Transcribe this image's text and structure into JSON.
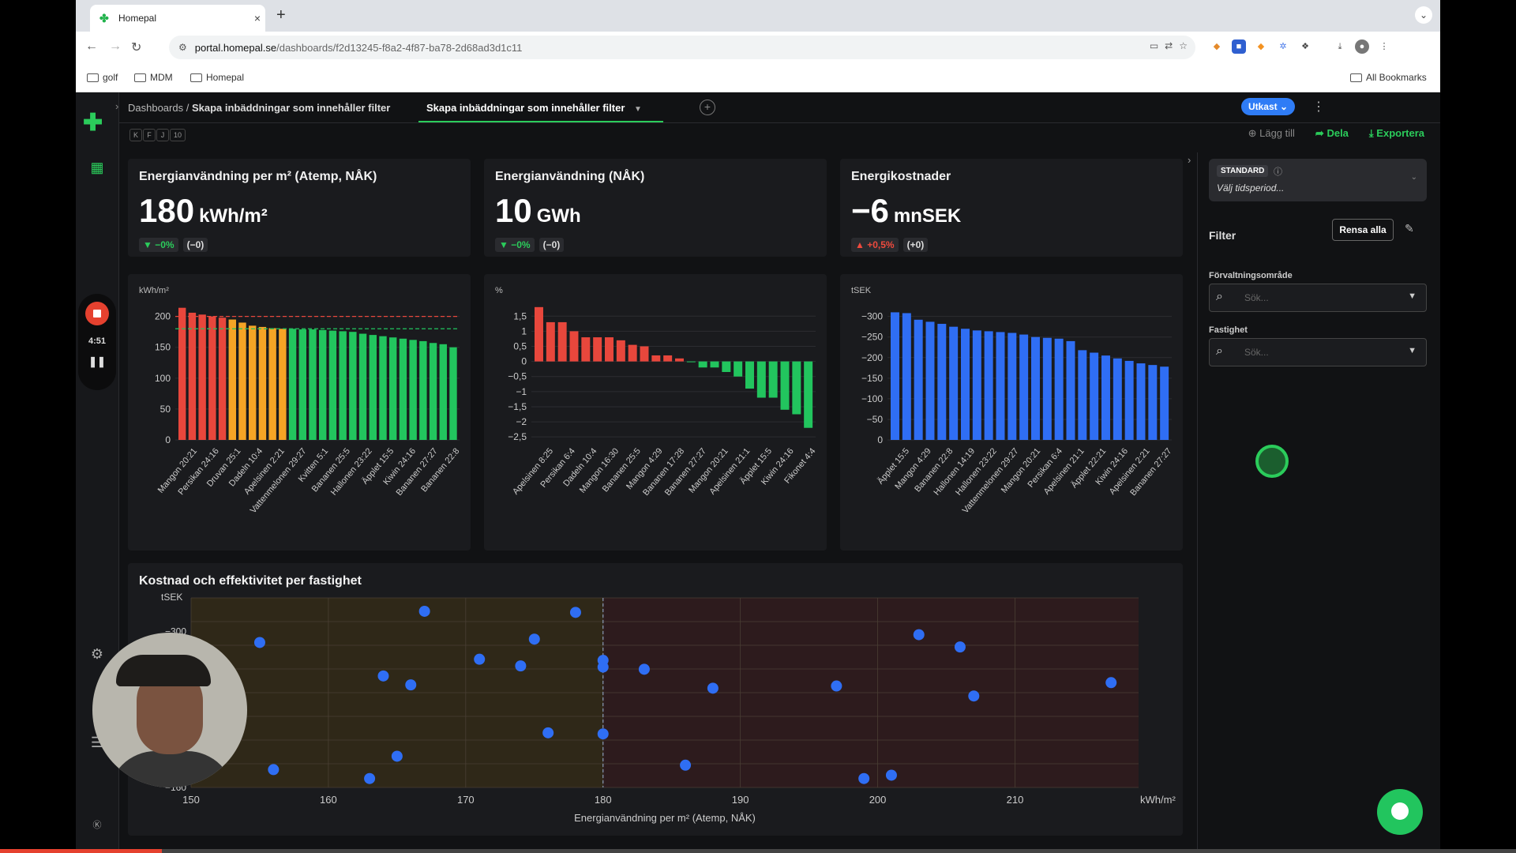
{
  "browser": {
    "tab_title": "Homepal",
    "tab_favicon": "homepal-icon",
    "url_host": "portal.homepal.se",
    "url_path": "/dashboards/f2d13245-f8a2-4f87-ba78-2d68ad3d1c11",
    "bookmarks": [
      "golf",
      "MDM",
      "Homepal"
    ],
    "all_bookmarks": "All Bookmarks"
  },
  "header": {
    "breadcrumb_root": "Dashboards /",
    "breadcrumb_current": "Skapa inbäddningar som innehåller filter",
    "active_tab": "Skapa inbäddningar som innehåller filter",
    "status_button": "Utkast"
  },
  "subbar": {
    "key_hints": [
      "K",
      "F",
      "J",
      "10"
    ],
    "add": "Lägg till",
    "share": "Dela",
    "export": "Exportera"
  },
  "recorder": {
    "time": "4:51"
  },
  "kpis": [
    {
      "title": "Energianvändning per m² (Atemp, NÅK)",
      "value": "180",
      "unit": "kWh/m²",
      "change": "−0%",
      "delta": "(−0)",
      "direction": "down"
    },
    {
      "title": "Energianvändning (NÅK)",
      "value": "10",
      "unit": "GWh",
      "change": "−0%",
      "delta": "(−0)",
      "direction": "down"
    },
    {
      "title": "Energikostnader",
      "value": "−6",
      "unit": "mnSEK",
      "change": "+0,5%",
      "delta": "(+0)",
      "direction": "up"
    }
  ],
  "chart_data": [
    {
      "type": "bar",
      "ylabel": "kWh/m²",
      "ylim": [
        0,
        220
      ],
      "yticks": [
        "0",
        "50",
        "100",
        "150",
        "200"
      ],
      "reference_lines": [
        200,
        180
      ],
      "categories": [
        "Mangon 20:21",
        "Persikan 24:16",
        "Druvan 25:1",
        "Dadeln 10:4",
        "Apelsinen 2:21",
        "Vattenmelonen 29:27",
        "Kvitten 5:1",
        "Bananen 25:5",
        "Hallonen 23:22",
        "Äpplet 15:5",
        "Kiwin 24:16",
        "Bananen 27:27",
        "Bananen 22:8"
      ],
      "values": [
        214,
        206,
        203,
        200,
        198,
        195,
        190,
        185,
        183,
        181,
        180,
        180,
        179,
        179,
        178,
        177,
        176,
        175,
        172,
        170,
        168,
        166,
        164,
        162,
        160,
        157,
        155,
        150
      ],
      "colors": [
        "#e8473c",
        "#e8473c",
        "#e8473c",
        "#e8473c",
        "#e8473c",
        "#f5a425",
        "#f5a425",
        "#f5a425",
        "#f5a425",
        "#f5a425",
        "#f5a425",
        "#22c55e",
        "#22c55e",
        "#22c55e",
        "#22c55e",
        "#22c55e",
        "#22c55e",
        "#22c55e",
        "#22c55e",
        "#22c55e",
        "#22c55e",
        "#22c55e",
        "#22c55e",
        "#22c55e",
        "#22c55e",
        "#22c55e",
        "#22c55e",
        "#22c55e"
      ]
    },
    {
      "type": "bar",
      "ylabel": "%",
      "ylim": [
        -2.6,
        1.9
      ],
      "yticks": [
        "−2,5",
        "−2",
        "−1,5",
        "−1",
        "−0,5",
        "0",
        "0,5",
        "1",
        "1,5"
      ],
      "categories": [
        "Apelsinen 8:25",
        "Persikan 6:4",
        "Dadeln 10:4",
        "Mangon 16:30",
        "Bananen 25:5",
        "Mangon 4:29",
        "Bananen 17:28",
        "Bananen 27:27",
        "Mangon 20:21",
        "Apelsinen 21:1",
        "Äpplet 15:5",
        "Kiwin 24:16",
        "Fikonet 4:4"
      ],
      "values": [
        1.8,
        1.3,
        1.3,
        1.0,
        0.8,
        0.8,
        0.8,
        0.7,
        0.55,
        0.5,
        0.2,
        0.2,
        0.1,
        0,
        -0.2,
        -0.2,
        -0.35,
        -0.5,
        -0.9,
        -1.2,
        -1.2,
        -1.6,
        -1.75,
        -2.2
      ],
      "colors": [
        "#e8473c",
        "#e8473c",
        "#e8473c",
        "#e8473c",
        "#e8473c",
        "#e8473c",
        "#e8473c",
        "#e8473c",
        "#e8473c",
        "#e8473c",
        "#e8473c",
        "#e8473c",
        "#e8473c",
        "#22c55e",
        "#22c55e",
        "#22c55e",
        "#22c55e",
        "#22c55e",
        "#22c55e",
        "#22c55e",
        "#22c55e",
        "#22c55e",
        "#22c55e",
        "#22c55e"
      ]
    },
    {
      "type": "bar",
      "ylabel": "tSEK",
      "ylim": [
        0,
        -330
      ],
      "yticks": [
        "0",
        "−50",
        "−100",
        "−150",
        "−200",
        "−250",
        "−300"
      ],
      "categories": [
        "Äpplet 15:5",
        "Mangon 4:29",
        "Bananen 22:8",
        "Hallonen 14:19",
        "Hallonen 23:22",
        "Vattenmelonen 29:27",
        "Mangon 20:21",
        "Persikan 6:4",
        "Apelsinen 21:1",
        "Äpplet 22:21",
        "Kiwin 24:16",
        "Apelsinen 2:21",
        "Bananen 27:27"
      ],
      "values": [
        -310,
        -308,
        -292,
        -287,
        -282,
        -275,
        -270,
        -266,
        -264,
        -262,
        -260,
        -256,
        -250,
        -248,
        -246,
        -240,
        -218,
        -212,
        -205,
        -198,
        -192,
        -186,
        -182,
        -178
      ],
      "colors": [
        "#2f6ef4"
      ]
    },
    {
      "type": "scatter",
      "title": "Kostnad och effektivitet per fastighet",
      "xlabel": "Energianvändning per m² (Atemp, NÅK)",
      "xunit": "kWh/m²",
      "ylabel": "tSEK",
      "xlim": [
        150,
        219
      ],
      "ylim": [
        -160,
        -330
      ],
      "xticks": [
        "150",
        "160",
        "170",
        "180",
        "190",
        "200",
        "210"
      ],
      "yticks": [
        "−160",
        "−300"
      ],
      "x_threshold": 180,
      "points": [
        {
          "x": 155,
          "y": -290
        },
        {
          "x": 156,
          "y": -176
        },
        {
          "x": 163,
          "y": -168
        },
        {
          "x": 164,
          "y": -260
        },
        {
          "x": 165,
          "y": -188
        },
        {
          "x": 166,
          "y": -252
        },
        {
          "x": 167,
          "y": -318
        },
        {
          "x": 171,
          "y": -275
        },
        {
          "x": 174,
          "y": -269
        },
        {
          "x": 175,
          "y": -293
        },
        {
          "x": 176,
          "y": -209
        },
        {
          "x": 178,
          "y": -317
        },
        {
          "x": 180,
          "y": -274
        },
        {
          "x": 180,
          "y": -268
        },
        {
          "x": 180,
          "y": -208
        },
        {
          "x": 183,
          "y": -266
        },
        {
          "x": 186,
          "y": -180
        },
        {
          "x": 188,
          "y": -249
        },
        {
          "x": 197,
          "y": -251
        },
        {
          "x": 199,
          "y": -168
        },
        {
          "x": 201,
          "y": -171
        },
        {
          "x": 203,
          "y": -297
        },
        {
          "x": 206,
          "y": -286
        },
        {
          "x": 207,
          "y": -242
        },
        {
          "x": 217,
          "y": -254
        }
      ],
      "colors": {
        "point": "#2f6ef4",
        "left_zone": "#2f2818",
        "right_zone": "#2d1b1d"
      }
    }
  ],
  "right_panel": {
    "standard_tag": "STANDARD",
    "period_placeholder": "Välj tidsperiod...",
    "filter_title": "Filter",
    "clear_all": "Rensa alla",
    "fields": [
      {
        "label": "Förvaltningsområde",
        "placeholder": "Sök..."
      },
      {
        "label": "Fastighet",
        "placeholder": "Sök..."
      }
    ]
  },
  "colors": {
    "accent": "#2bcc5b",
    "brand_blue": "#2f7cf6",
    "record": "#e5412f"
  }
}
